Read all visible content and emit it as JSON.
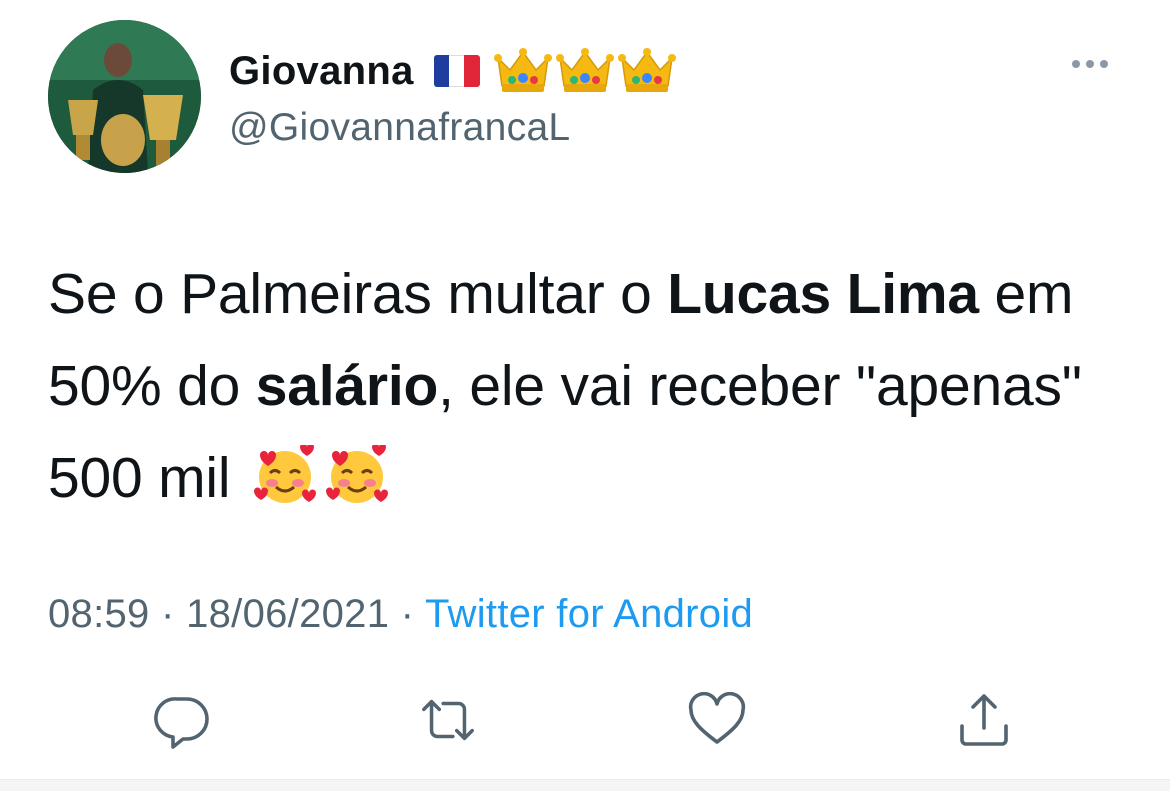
{
  "author": {
    "name": "Giovanna",
    "handle": "@GiovannafrancaL",
    "name_emojis": [
      "flag-france-icon",
      "crown-icon",
      "crown-icon",
      "crown-icon"
    ]
  },
  "tweet": {
    "segments": [
      {
        "text": "Se o Palmeiras multar o ",
        "bold": false
      },
      {
        "text": "Lucas Lima",
        "bold": true
      },
      {
        "text": " em 50% do ",
        "bold": false
      },
      {
        "text": "salário",
        "bold": true
      },
      {
        "text": ", ele vai receber \"apenas\" 500 mil",
        "bold": false
      }
    ],
    "trailing_emojis": [
      "smiling-face-with-hearts-icon",
      "smiling-face-with-hearts-icon"
    ]
  },
  "meta": {
    "time": "08:59",
    "separator": " · ",
    "date": "18/06/2021",
    "source": "Twitter for Android"
  },
  "actions": [
    {
      "name": "reply",
      "icon": "reply-icon"
    },
    {
      "name": "retweet",
      "icon": "retweet-icon"
    },
    {
      "name": "like",
      "icon": "heart-icon"
    },
    {
      "name": "share",
      "icon": "share-icon"
    }
  ],
  "colors": {
    "text": "#0f1419",
    "secondary": "#536471",
    "link": "#1d9bf0",
    "icon": "#536471"
  }
}
